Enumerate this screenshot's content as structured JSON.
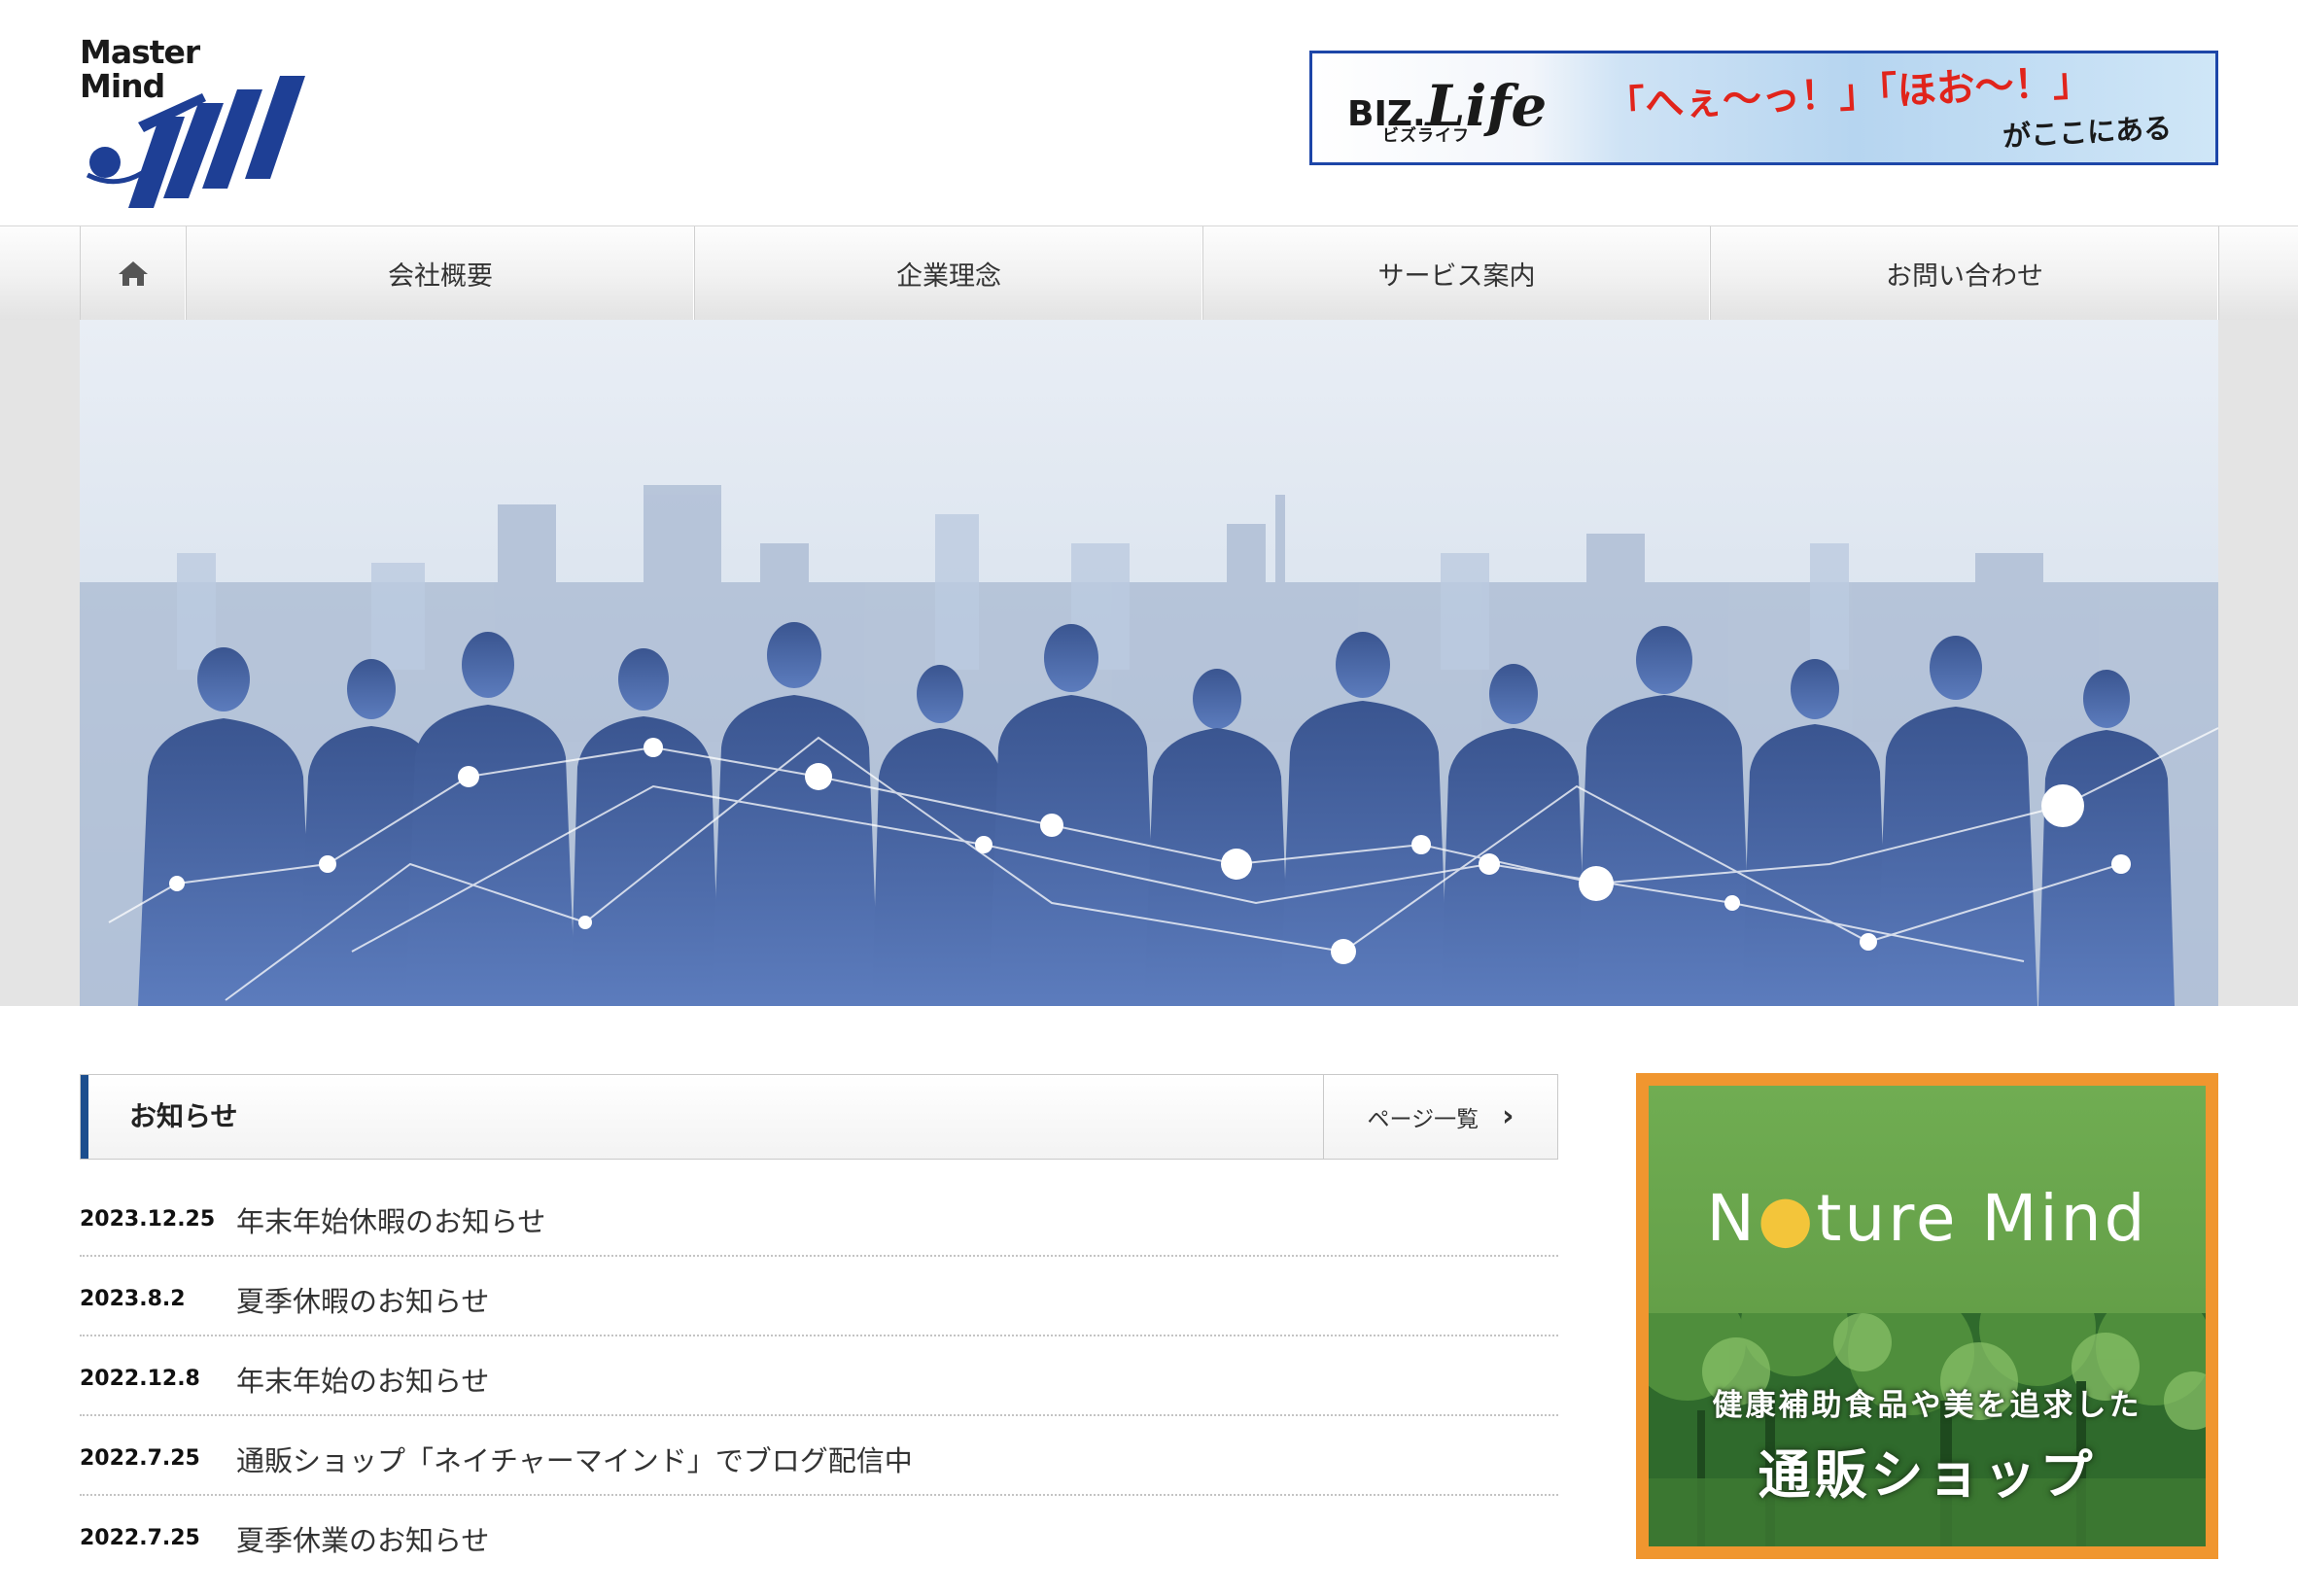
{
  "logo": {
    "line1": "Master",
    "line2": "Mind"
  },
  "ad_banner": {
    "brand": "BIZ.",
    "brand_script": "Life",
    "brand_kana": "ビズライフ",
    "quote": "「へぇ～っ！」「ほお～！」",
    "tagline": "がここにある"
  },
  "nav": {
    "home_icon": "home-icon",
    "items": [
      {
        "label": "会社概要"
      },
      {
        "label": "企業理念"
      },
      {
        "label": "サービス案内"
      },
      {
        "label": "お問い合わせ"
      }
    ]
  },
  "news": {
    "title": "お知らせ",
    "more_label": "ページ一覧",
    "more_icon": "chevron-right-icon",
    "items": [
      {
        "date": "2023.12.25",
        "text": "年末年始休暇のお知らせ"
      },
      {
        "date": "2023.8.2",
        "text": "夏季休暇のお知らせ"
      },
      {
        "date": "2022.12.8",
        "text": "年末年始のお知らせ"
      },
      {
        "date": "2022.7.25",
        "text": "通販ショップ「ネイチャーマインド」でブログ配信中"
      },
      {
        "date": "2022.7.25",
        "text": "夏季休業のお知らせ"
      }
    ]
  },
  "side_banner": {
    "brand_a": "N",
    "brand_b": "ture Mind",
    "caption1": "健康補助食品や美を追求した",
    "caption2": "通販ショップ"
  },
  "colors": {
    "accent_blue": "#1c4e8e",
    "banner_border": "#1d46a8",
    "side_banner_frame": "#f0962f",
    "side_banner_green": "#6aa84f"
  }
}
